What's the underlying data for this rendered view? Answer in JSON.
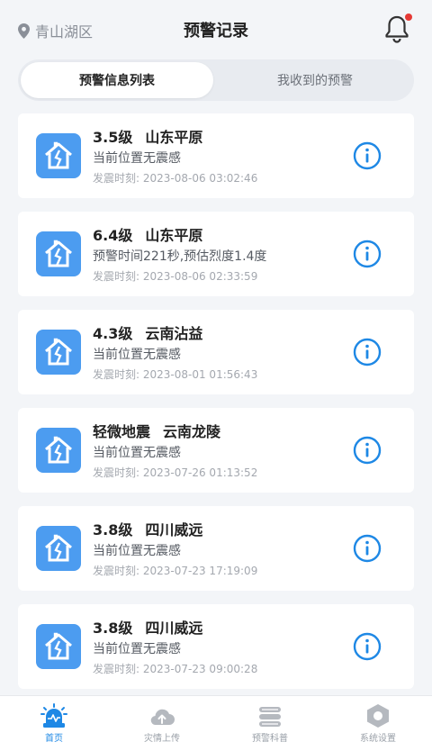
{
  "header": {
    "location": "青山湖区",
    "title": "预警记录"
  },
  "tabs": [
    {
      "label": "预警信息列表",
      "active": true
    },
    {
      "label": "我收到的预警",
      "active": false
    }
  ],
  "records": [
    {
      "magnitude": "3.5级",
      "place": "山东平原",
      "desc": "当前位置无震感",
      "time_label": "发震时刻:",
      "time": "2023-08-06 03:02:46"
    },
    {
      "magnitude": "6.4级",
      "place": "山东平原",
      "desc": "预警时间221秒,预估烈度1.4度",
      "time_label": "发震时刻:",
      "time": "2023-08-06 02:33:59"
    },
    {
      "magnitude": "4.3级",
      "place": "云南沾益",
      "desc": "当前位置无震感",
      "time_label": "发震时刻:",
      "time": "2023-08-01 01:56:43"
    },
    {
      "magnitude": "轻微地震",
      "place": "云南龙陵",
      "desc": "当前位置无震感",
      "time_label": "发震时刻:",
      "time": "2023-07-26 01:13:52"
    },
    {
      "magnitude": "3.8级",
      "place": "四川威远",
      "desc": "当前位置无震感",
      "time_label": "发震时刻:",
      "time": "2023-07-23 17:19:09"
    },
    {
      "magnitude": "3.8级",
      "place": "四川威远",
      "desc": "当前位置无震感",
      "time_label": "发震时刻:",
      "time": "2023-07-23 09:00:28"
    }
  ],
  "tabbar": [
    {
      "label": "首页",
      "icon": "alarm-icon",
      "active": true
    },
    {
      "label": "灾情上传",
      "icon": "cloud-upload-icon",
      "active": false
    },
    {
      "label": "预警科普",
      "icon": "book-icon",
      "active": false
    },
    {
      "label": "系统设置",
      "icon": "settings-icon",
      "active": false
    }
  ],
  "colors": {
    "accent": "#1e88e5",
    "icon_bg": "#4c9cf0",
    "badge": "#e53935",
    "page_bg": "#f3f5f8"
  }
}
